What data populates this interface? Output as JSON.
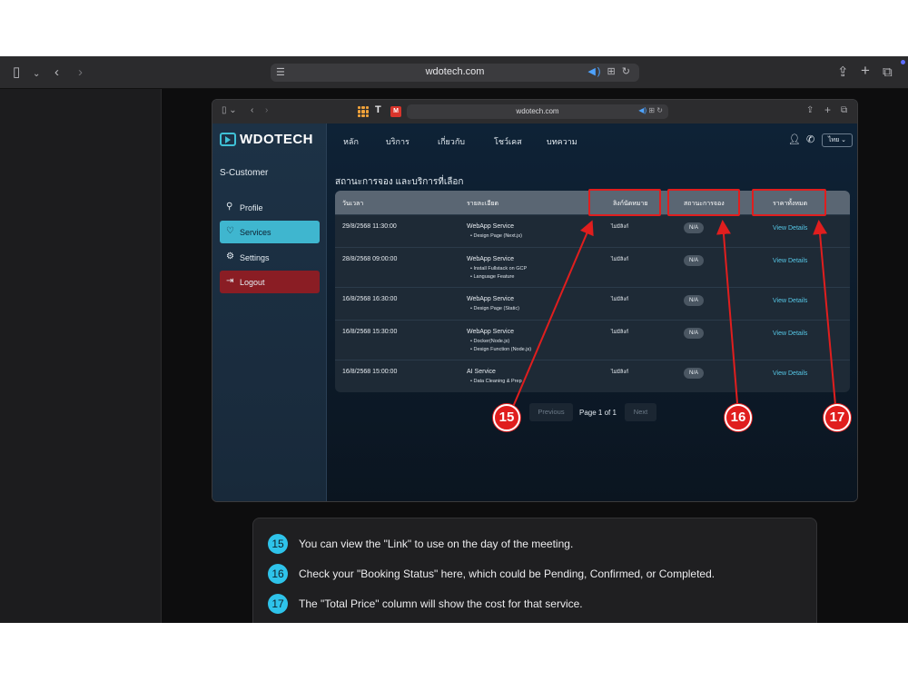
{
  "outer_browser": {
    "url": "wdotech.com"
  },
  "inner_browser": {
    "url": "wdotech.com"
  },
  "site": {
    "logo": "WDOTECH",
    "nav": [
      "หลัก",
      "บริการ",
      "เกี่ยวกับ",
      "โชว์เคส",
      "บทความ"
    ],
    "language": "ไทย",
    "sidebar": {
      "title": "S-Customer",
      "items": [
        {
          "label": "Profile",
          "icon": "user-icon"
        },
        {
          "label": "Services",
          "icon": "heart-icon"
        },
        {
          "label": "Settings",
          "icon": "gear-icon"
        },
        {
          "label": "Logout",
          "icon": "logout-icon"
        }
      ]
    },
    "section_title": "สถานะการจอง และบริการที่เลือก",
    "table": {
      "headers": [
        "วันเวลา",
        "รายละเอียด",
        "ลิงก์นัดหมาย",
        "สถานะการจอง",
        "ราคาทั้งหมด"
      ],
      "rows": [
        {
          "datetime": "29/8/2568 11:30:00",
          "service": "WebApp Service",
          "items": [
            "Design Page (Next.js)"
          ],
          "link": "ไม่มีลิงก์",
          "status": "N/A",
          "price": "View Details"
        },
        {
          "datetime": "28/8/2568 09:00:00",
          "service": "WebApp Service",
          "items": [
            "Install Fullstack on GCP",
            "Language Feature"
          ],
          "link": "ไม่มีลิงก์",
          "status": "N/A",
          "price": "View Details"
        },
        {
          "datetime": "16/8/2568 16:30:00",
          "service": "WebApp Service",
          "items": [
            "Design Page (Static)"
          ],
          "link": "ไม่มีลิงก์",
          "status": "N/A",
          "price": "View Details"
        },
        {
          "datetime": "16/8/2568 15:30:00",
          "service": "WebApp Service",
          "items": [
            "Docker(Node.js)",
            "Design Function (Node.js)"
          ],
          "link": "ไม่มีลิงก์",
          "status": "N/A",
          "price": "View Details"
        },
        {
          "datetime": "16/8/2568 15:00:00",
          "service": "AI Service",
          "items": [
            "Data Cleaning & Prep"
          ],
          "link": "ไม่มีลิงก์",
          "status": "N/A",
          "price": "View Details"
        }
      ]
    },
    "pagination": {
      "previous": "Previous",
      "page": "Page 1 of 1",
      "next": "Next"
    }
  },
  "annotations": {
    "badges": [
      "15",
      "16",
      "17"
    ],
    "color": "#e01e1e"
  },
  "notes": [
    {
      "num": "15",
      "text": "You can view the \"Link\" to use on the day of the meeting."
    },
    {
      "num": "16",
      "text": "Check your \"Booking Status\" here, which could be Pending, Confirmed, or Completed."
    },
    {
      "num": "17",
      "text": "The \"Total Price\" column will show the cost for that service."
    }
  ],
  "colors": {
    "accent": "#3fb6cf",
    "logout": "#8a1d24",
    "link": "#56c7e6",
    "note_badge": "#2ec3ea"
  }
}
